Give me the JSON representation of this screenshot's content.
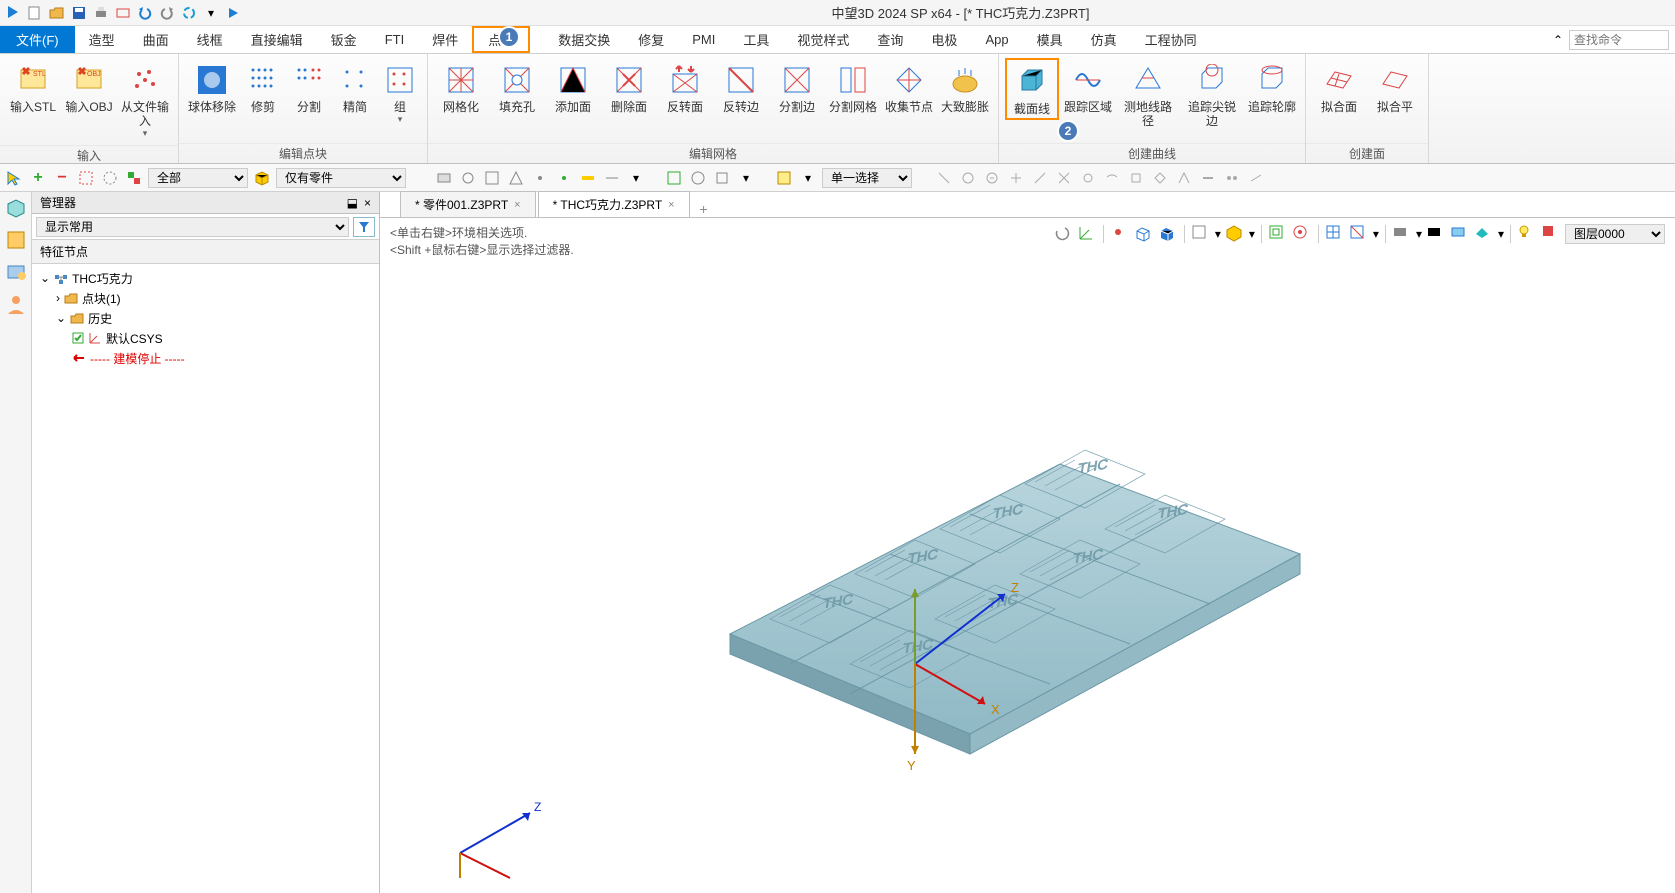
{
  "app": {
    "title": "中望3D 2024 SP x64 - [* THC巧克力.Z3PRT]"
  },
  "search": {
    "placeholder": "查找命令"
  },
  "menu": {
    "file": "文件(F)",
    "items": [
      "造型",
      "曲面",
      "线框",
      "直接编辑",
      "钣金",
      "FTI",
      "焊件",
      "点云",
      "数据交换",
      "修复",
      "PMI",
      "工具",
      "视觉样式",
      "查询",
      "电极",
      "App",
      "模具",
      "仿真",
      "工程协同"
    ]
  },
  "ribbon": {
    "groups": [
      {
        "label": "输入",
        "buttons": [
          "输入STL",
          "输入OBJ",
          "从文件输入"
        ]
      },
      {
        "label": "编辑点块",
        "buttons": [
          "球体移除",
          "修剪",
          "分割",
          "精简",
          "组"
        ]
      },
      {
        "label": "编辑网格",
        "buttons": [
          "网格化",
          "填充孔",
          "添加面",
          "删除面",
          "反转面",
          "反转边",
          "分割边",
          "分割网格",
          "收集节点",
          "大致膨胀"
        ]
      },
      {
        "label": "创建曲线",
        "buttons": [
          "截面线",
          "跟踪区域",
          "测地线路径",
          "追踪尖锐边",
          "追踪轮廓"
        ]
      },
      {
        "label": "创建面",
        "buttons": [
          "拟合面",
          "拟合平"
        ]
      }
    ]
  },
  "selbar": {
    "combo1": "全部",
    "combo2": "仅有零件",
    "combo3": "单一选择"
  },
  "hints": {
    "line1": "<单击右键>环境相关选项.",
    "line2": "<Shift +鼠标右键>显示选择过滤器."
  },
  "manager": {
    "title": "管理器",
    "display": "显示常用",
    "feat_header": "特征节点",
    "tree": {
      "root": "THC巧克力",
      "blocks": "点块(1)",
      "history": "历史",
      "csys": "默认CSYS",
      "stop": "----- 建模停止 -----"
    }
  },
  "tabs": {
    "tab1": "* 零件001.Z3PRT",
    "tab2": "* THC巧克力.Z3PRT"
  },
  "viewport": {
    "layer": "图层0000",
    "axisX": "X",
    "axisY": "Y",
    "axisZ": "Z"
  },
  "badges": {
    "b1": "1",
    "b2": "2"
  }
}
